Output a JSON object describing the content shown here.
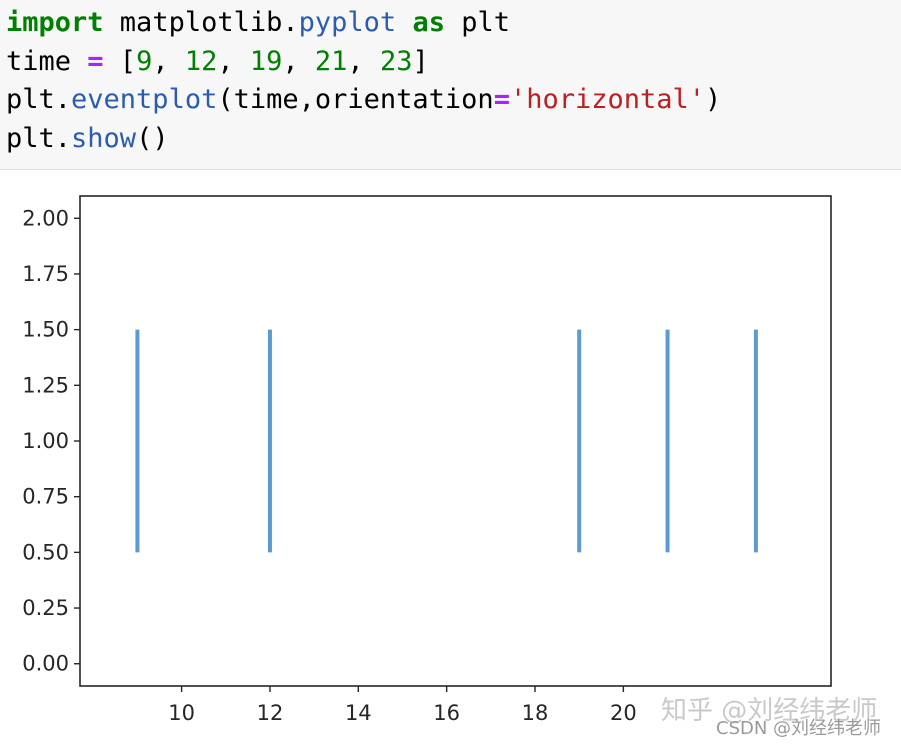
{
  "code": {
    "line1": {
      "kw1": "import",
      "t1": " matplotlib.",
      "fn1": "pyplot",
      "t2": " ",
      "kw2": "as",
      "t3": " plt"
    },
    "line2": {
      "t1": "time ",
      "op": "=",
      "t2": " [",
      "n1": "9",
      "c1": ", ",
      "n2": "12",
      "c2": ", ",
      "n3": "19",
      "c3": ", ",
      "n4": "21",
      "c4": ", ",
      "n5": "23",
      "t3": "]"
    },
    "line3": {
      "t1": "plt.",
      "fn": "eventplot",
      "t2": "(time,orientation",
      "op": "=",
      "str": "'horizontal'",
      "t3": ")"
    },
    "line4": {
      "t1": "plt.",
      "fn": "show",
      "t2": "()"
    }
  },
  "chart_data": {
    "type": "eventplot",
    "orientation": "horizontal",
    "events": [
      9,
      12,
      19,
      21,
      23
    ],
    "lineoffset": 1.0,
    "linelength": 1.0,
    "xlim": [
      7.7,
      24.7
    ],
    "ylim": [
      -0.1,
      2.1
    ],
    "xticks": [
      "10",
      "12",
      "14",
      "16",
      "18",
      "20"
    ],
    "yticks": [
      "0.00",
      "0.25",
      "0.50",
      "0.75",
      "1.00",
      "1.25",
      "1.50",
      "1.75",
      "2.00"
    ],
    "color": "#5b9bd0"
  },
  "watermark": {
    "text1": "知乎 @刘经纬老师",
    "text2": "CSDN @刘经纬老师"
  }
}
